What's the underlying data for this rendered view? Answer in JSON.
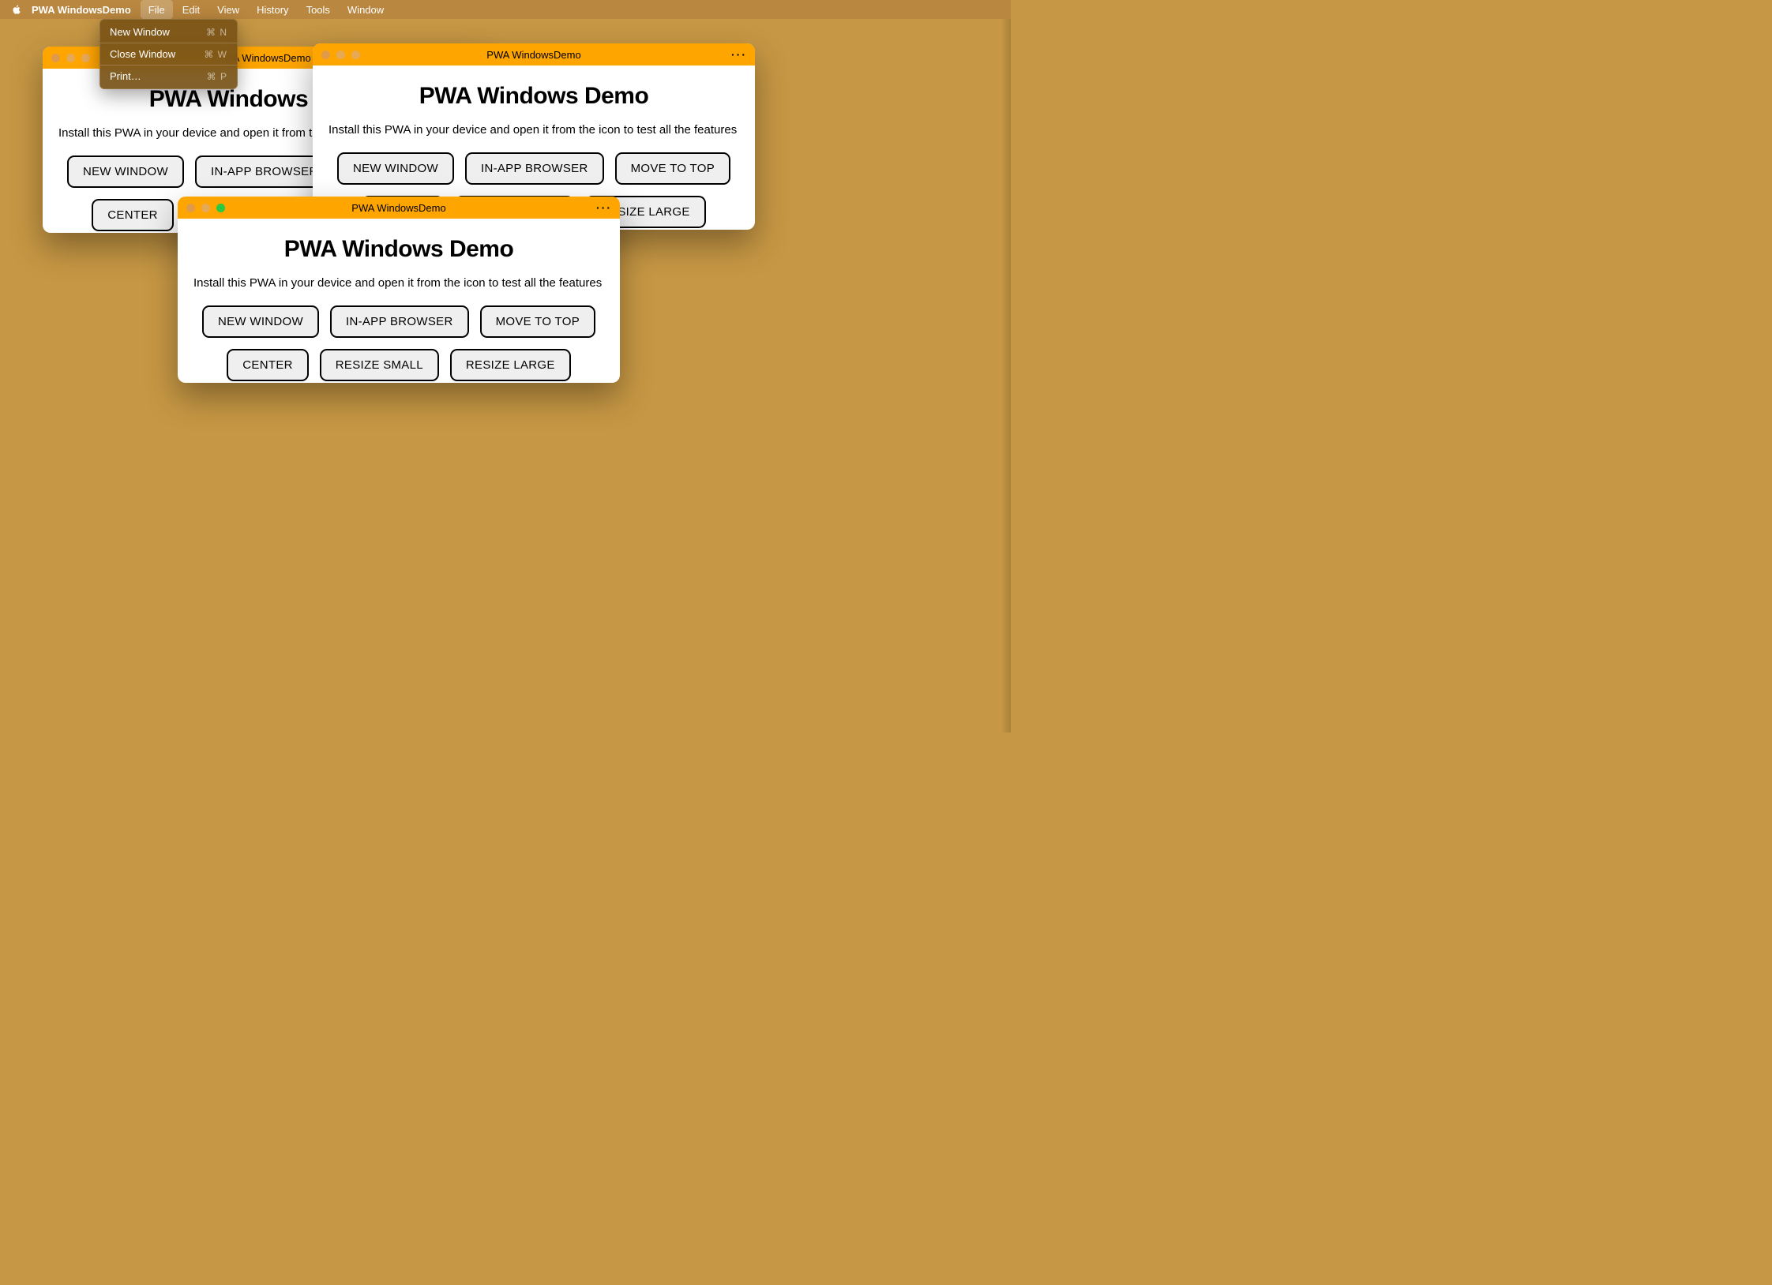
{
  "menubar": {
    "app_name": "PWA WindowsDemo",
    "items": [
      "File",
      "Edit",
      "View",
      "History",
      "Tools",
      "Window"
    ],
    "active_index": 0
  },
  "file_menu": {
    "items": [
      {
        "label": "New Window",
        "shortcut": "⌘ N"
      },
      {
        "label": "Close Window",
        "shortcut": "⌘ W"
      },
      {
        "label": "Print…",
        "shortcut": "⌘ P"
      }
    ]
  },
  "pwa": {
    "window_title": "PWA WindowsDemo",
    "heading": "PWA Windows Demo",
    "description": "Install this PWA in your device and open it from the icon to test all the features",
    "buttons": [
      "NEW WINDOW",
      "IN-APP BROWSER",
      "MOVE TO TOP",
      "CENTER",
      "RESIZE SMALL",
      "RESIZE LARGE"
    ]
  },
  "windows": [
    {
      "id": "back-left",
      "focused": false
    },
    {
      "id": "back-right",
      "focused": false
    },
    {
      "id": "front",
      "focused": true
    }
  ]
}
